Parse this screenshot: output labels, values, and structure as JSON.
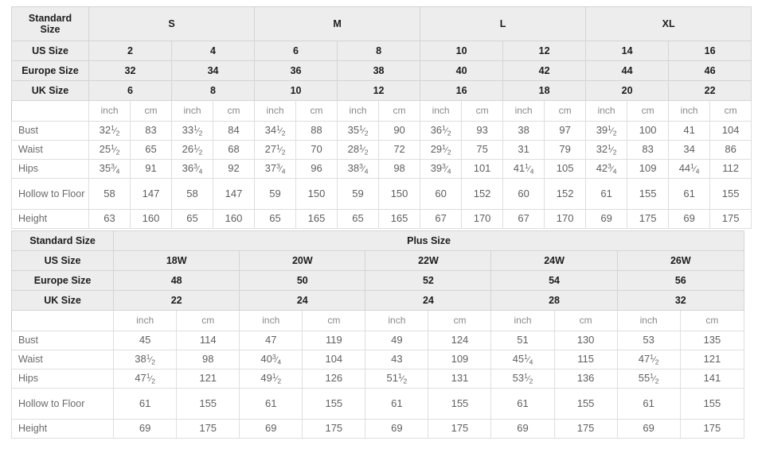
{
  "standard_table": {
    "row_labels": {
      "standard_size": "Standard Size",
      "us_size": "US Size",
      "europe_size": "Europe Size",
      "uk_size": "UK Size",
      "bust": "Bust",
      "waist": "Waist",
      "hips": "Hips",
      "hollow_to_floor": "Hollow to Floor",
      "height": "Height"
    },
    "units": {
      "inch": "inch",
      "cm": "cm"
    },
    "size_groups": [
      {
        "label": "S",
        "columns": 2
      },
      {
        "label": "M",
        "columns": 2
      },
      {
        "label": "L",
        "columns": 2
      },
      {
        "label": "XL",
        "columns": 2
      }
    ],
    "us_size": [
      "2",
      "4",
      "6",
      "8",
      "10",
      "12",
      "14",
      "16"
    ],
    "europe_size": [
      "32",
      "34",
      "36",
      "38",
      "40",
      "42",
      "44",
      "46"
    ],
    "uk_size": [
      "6",
      "8",
      "10",
      "12",
      "16",
      "18",
      "20",
      "22"
    ],
    "measurements": [
      {
        "label": "Bust",
        "inch": [
          "32 1/2",
          "33 1/2",
          "34 1/2",
          "35 1/2",
          "36 1/2",
          "38",
          "39 1/2",
          "41"
        ],
        "cm": [
          "83",
          "84",
          "88",
          "90",
          "93",
          "97",
          "100",
          "104"
        ]
      },
      {
        "label": "Waist",
        "inch": [
          "25 1/2",
          "26 1/2",
          "27 1/2",
          "28 1/2",
          "29 1/2",
          "31",
          "32 1/2",
          "34"
        ],
        "cm": [
          "65",
          "68",
          "70",
          "72",
          "75",
          "79",
          "83",
          "86"
        ]
      },
      {
        "label": "Hips",
        "inch": [
          "35 3/4",
          "36 3/4",
          "37 3/4",
          "38 3/4",
          "39 3/4",
          "41 1/4",
          "42 3/4",
          "44 1/4"
        ],
        "cm": [
          "91",
          "92",
          "96",
          "98",
          "101",
          "105",
          "109",
          "112"
        ]
      },
      {
        "label": "Hollow to Floor",
        "inch": [
          "58",
          "58",
          "59",
          "59",
          "60",
          "60",
          "61",
          "61"
        ],
        "cm": [
          "147",
          "147",
          "150",
          "150",
          "152",
          "152",
          "155",
          "155"
        ]
      },
      {
        "label": "Height",
        "inch": [
          "63",
          "65",
          "65",
          "65",
          "67",
          "67",
          "69",
          "69"
        ],
        "cm": [
          "160",
          "160",
          "165",
          "165",
          "170",
          "170",
          "175",
          "175"
        ]
      }
    ]
  },
  "plus_table": {
    "row_labels": {
      "standard_size": "Standard Size",
      "us_size": "US Size",
      "europe_size": "Europe Size",
      "uk_size": "UK Size"
    },
    "group_title": "Plus Size",
    "units": {
      "inch": "inch",
      "cm": "cm"
    },
    "us_size": [
      "18W",
      "20W",
      "22W",
      "24W",
      "26W"
    ],
    "europe_size": [
      "48",
      "50",
      "52",
      "54",
      "56"
    ],
    "uk_size": [
      "22",
      "24",
      "24",
      "28",
      "32"
    ],
    "measurements": [
      {
        "label": "Bust",
        "inch": [
          "45",
          "47",
          "49",
          "51",
          "53"
        ],
        "cm": [
          "114",
          "119",
          "124",
          "130",
          "135"
        ]
      },
      {
        "label": "Waist",
        "inch": [
          "38 1/2",
          "40 3/4",
          "43",
          "45 1/4",
          "47 1/2"
        ],
        "cm": [
          "98",
          "104",
          "109",
          "115",
          "121"
        ]
      },
      {
        "label": "Hips",
        "inch": [
          "47 1/2",
          "49 1/2",
          "51 1/2",
          "53 1/2",
          "55 1/2"
        ],
        "cm": [
          "121",
          "126",
          "131",
          "136",
          "141"
        ]
      },
      {
        "label": "Hollow to Floor",
        "inch": [
          "61",
          "61",
          "61",
          "61",
          "61"
        ],
        "cm": [
          "155",
          "155",
          "155",
          "155",
          "155"
        ]
      },
      {
        "label": "Height",
        "inch": [
          "69",
          "69",
          "69",
          "69",
          "69"
        ],
        "cm": [
          "175",
          "175",
          "175",
          "175",
          "175"
        ]
      }
    ]
  },
  "colors": {
    "header_bg": "#ededed",
    "border": "#dedede",
    "outer_border": "#c9c9c9",
    "header_text": "#1c1c1c",
    "body_text": "#5f5f5f",
    "unit_text": "#8a8a8a",
    "page_bg": "#ffffff"
  }
}
